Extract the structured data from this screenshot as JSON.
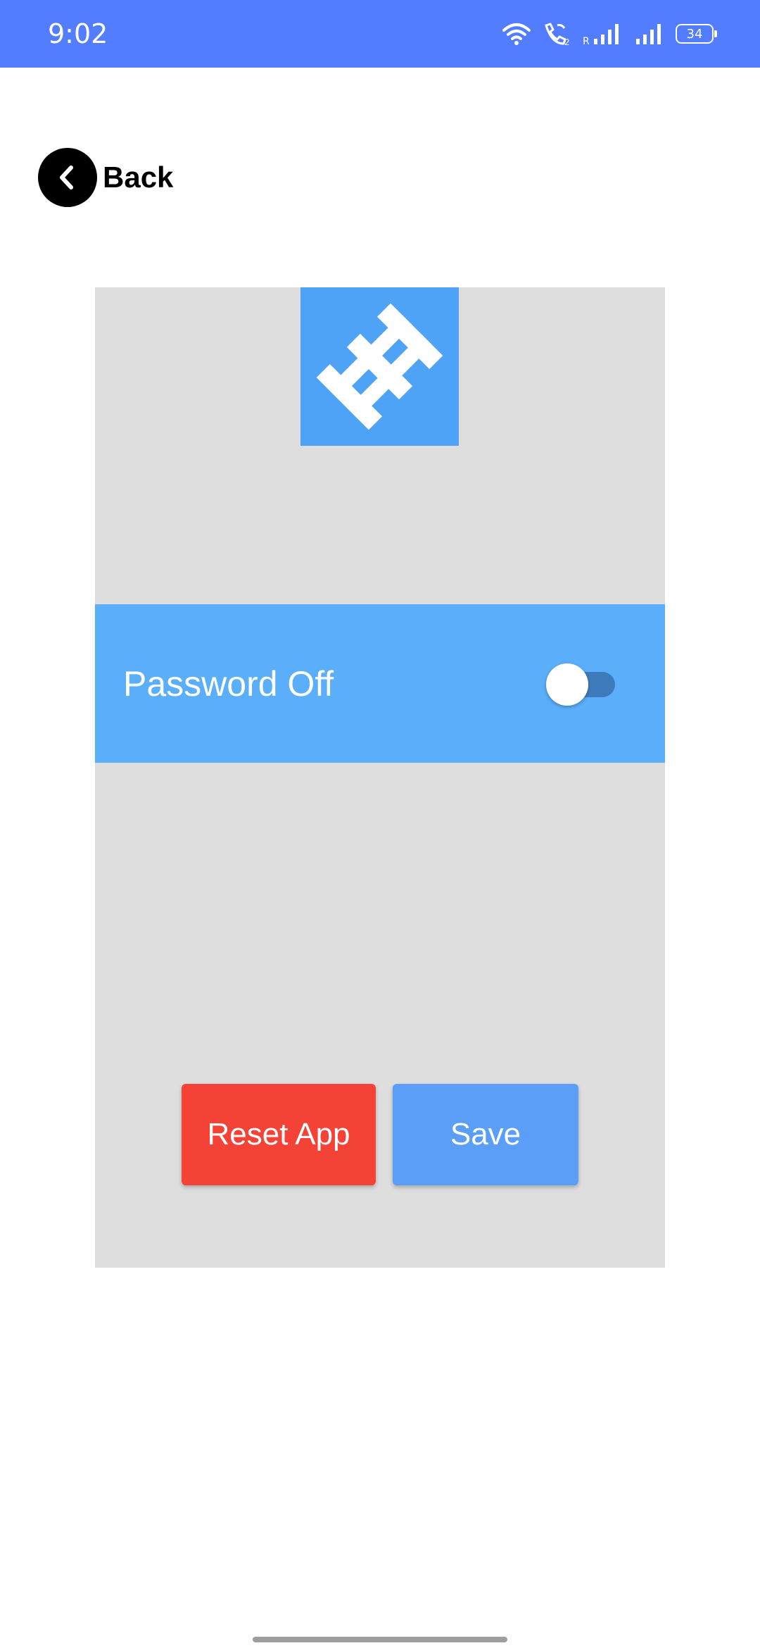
{
  "status_bar": {
    "time": "9:02",
    "battery": "34",
    "background": "#527DFF",
    "icons": [
      "wifi-icon",
      "wifi-call-icon",
      "signal-roaming-icon",
      "signal-icon",
      "battery-icon"
    ]
  },
  "nav": {
    "back_label": "Back",
    "back_icon": "chevron-left-icon"
  },
  "settings": {
    "logo_icon": "app-logo-icon",
    "password_label": "Password Off",
    "password_enabled": false,
    "reset_label": "Reset App",
    "save_label": "Save"
  },
  "colors": {
    "card_bg": "#DEDEDE",
    "logo_bg": "#4FA3F7",
    "row_bg": "#5BAEF9",
    "reset_bg": "#F44336",
    "save_bg": "#5B9EF8"
  }
}
